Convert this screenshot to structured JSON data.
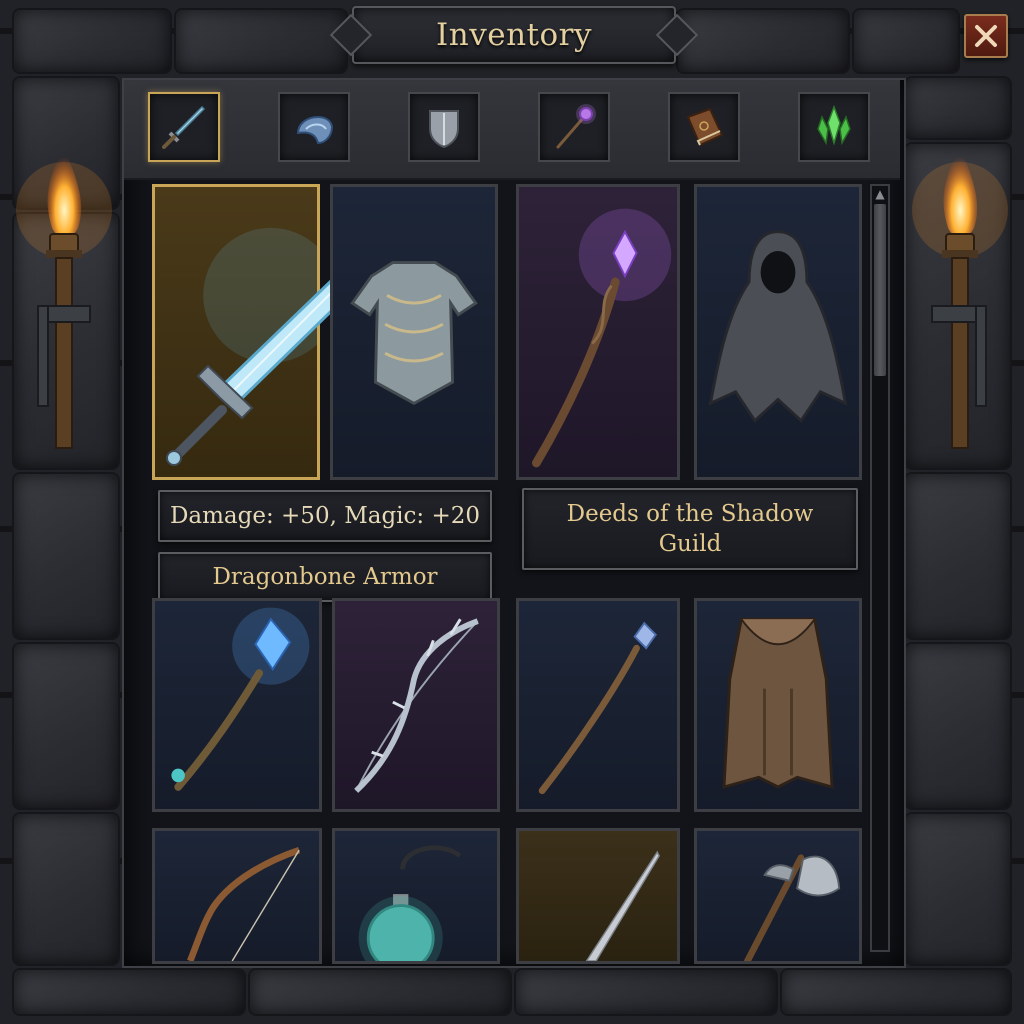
{
  "window": {
    "title": "Inventory",
    "close_icon": "close-icon",
    "accent_color": "#c9a558",
    "close_color": "#7a2c1d"
  },
  "tabs": [
    {
      "id": "weapons",
      "icon": "sword-icon",
      "active": true
    },
    {
      "id": "helmets",
      "icon": "helmet-icon",
      "active": false
    },
    {
      "id": "shields",
      "icon": "shield-icon",
      "active": false
    },
    {
      "id": "staves",
      "icon": "staff-icon",
      "active": false
    },
    {
      "id": "books",
      "icon": "book-icon",
      "active": false
    },
    {
      "id": "gems",
      "icon": "gem-icon",
      "active": false
    }
  ],
  "items": [
    {
      "icon": "glowing-sword-icon",
      "selected": true
    },
    {
      "icon": "scale-armor-icon"
    },
    {
      "icon": "purple-crystal-staff-icon"
    },
    {
      "icon": "hooded-cloak-icon"
    },
    {
      "icon": "blue-crystal-staff-icon"
    },
    {
      "icon": "thorned-bow-icon"
    },
    {
      "icon": "wooden-wand-icon"
    },
    {
      "icon": "leather-cape-icon"
    },
    {
      "icon": "recurve-bow-icon"
    },
    {
      "icon": "potion-flask-icon"
    },
    {
      "icon": "thin-blade-icon"
    },
    {
      "icon": "battle-axe-icon"
    }
  ],
  "tooltips": {
    "stats": "Damage: +50, Magic: +20",
    "item_name": "Dragonbone Armor",
    "book_title": "Deeds of the Shadow Guild"
  },
  "scrollbar": {
    "position": 0.0,
    "up_arrow": "▲"
  }
}
